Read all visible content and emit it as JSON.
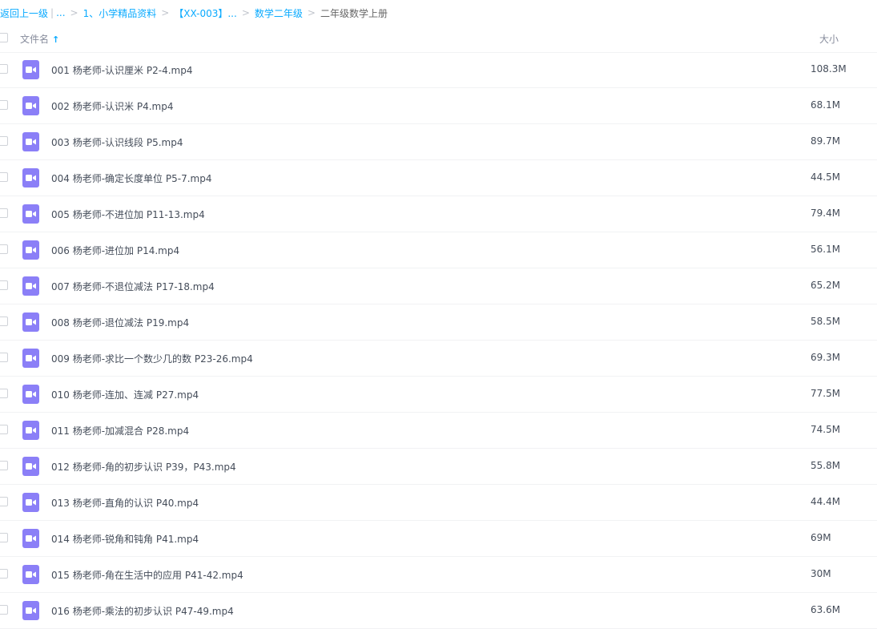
{
  "breadcrumb": {
    "back_label": "返回上一级",
    "sep_bar": "|",
    "ellipsis": "...",
    "items": [
      "1、小学精品资料",
      "【XX-003】...",
      "数学二年级"
    ],
    "current": "二年级数学上册",
    "chevron": ">"
  },
  "header": {
    "name_label": "文件名",
    "sort_icon": "↑",
    "size_label": "大小"
  },
  "files": [
    {
      "name": "001 杨老师-认识厘米 P2-4.mp4",
      "size": "108.3M"
    },
    {
      "name": "002 杨老师-认识米 P4.mp4",
      "size": "68.1M"
    },
    {
      "name": "003 杨老师-认识线段 P5.mp4",
      "size": "89.7M"
    },
    {
      "name": "004 杨老师-确定长度单位 P5-7.mp4",
      "size": "44.5M"
    },
    {
      "name": "005 杨老师-不进位加 P11-13.mp4",
      "size": "79.4M"
    },
    {
      "name": "006 杨老师-进位加 P14.mp4",
      "size": "56.1M"
    },
    {
      "name": "007 杨老师-不退位减法 P17-18.mp4",
      "size": "65.2M"
    },
    {
      "name": "008 杨老师-退位减法 P19.mp4",
      "size": "58.5M"
    },
    {
      "name": "009 杨老师-求比一个数少几的数 P23-26.mp4",
      "size": "69.3M"
    },
    {
      "name": "010 杨老师-连加、连减 P27.mp4",
      "size": "77.5M"
    },
    {
      "name": "011 杨老师-加减混合 P28.mp4",
      "size": "74.5M"
    },
    {
      "name": "012 杨老师-角的初步认识 P39，P43.mp4",
      "size": "55.8M"
    },
    {
      "name": "013 杨老师-直角的认识 P40.mp4",
      "size": "44.4M"
    },
    {
      "name": "014 杨老师-锐角和钝角 P41.mp4",
      "size": "69M"
    },
    {
      "name": "015 杨老师-角在生活中的应用 P41-42.mp4",
      "size": "30M"
    },
    {
      "name": "016 杨老师-乘法的初步认识 P47-49.mp4",
      "size": "63.6M"
    }
  ],
  "icons": {
    "file": "video-file-icon",
    "sort": "arrow-up-icon"
  },
  "colors": {
    "accent": "#09aaff",
    "video_icon": "#8b7ff7",
    "text": "#454d5a"
  }
}
